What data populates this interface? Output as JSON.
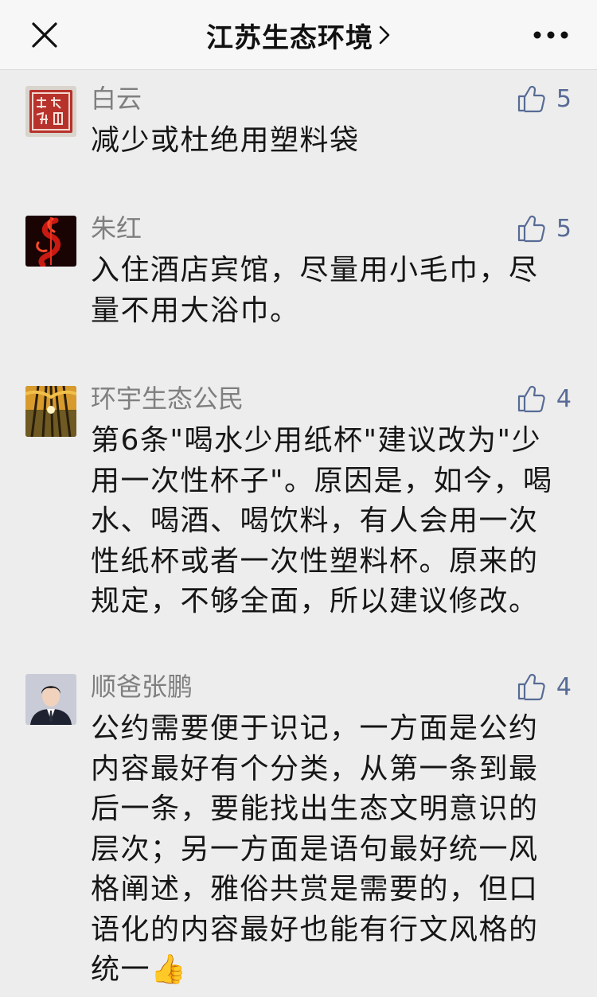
{
  "header": {
    "title": "江苏生态环境",
    "close_icon": "close-icon",
    "more_icon": "more-icon",
    "chevron_icon": "chevron-right-icon"
  },
  "colors": {
    "nickname": "#7f7f7f",
    "like": "#576b95",
    "text": "#161616",
    "background": "#ededed"
  },
  "comments": [
    {
      "nickname": "白云",
      "likes": "5",
      "content": "减少或杜绝用塑料袋",
      "avatar": "seal-stamp-avatar"
    },
    {
      "nickname": "朱红",
      "likes": "5",
      "content": "入住酒店宾馆，尽量用小毛巾，尽量不用大浴巾。",
      "avatar": "red-smoke-avatar"
    },
    {
      "nickname": "环宇生态公民",
      "likes": "4",
      "content": "第6条\"喝水少用纸杯\"建议改为\"少用一次性杯子\"。原因是，如今，喝水、喝酒、喝饮料，有人会用一次性纸杯或者一次性塑料杯。原来的规定，不够全面，所以建议修改。",
      "avatar": "forest-avatar"
    },
    {
      "nickname": "顺爸张鹏",
      "likes": "4",
      "content": "公约需要便于识记，一方面是公约内容最好有个分类，从第一条到最后一条，要能找出生态文明意识的层次；另一方面是语句最好统一风格阐述，雅俗共赏是需要的，但口语化的内容最好也能有行文风格的统一",
      "emoji": "👍",
      "avatar": "man-in-suit-avatar"
    }
  ]
}
